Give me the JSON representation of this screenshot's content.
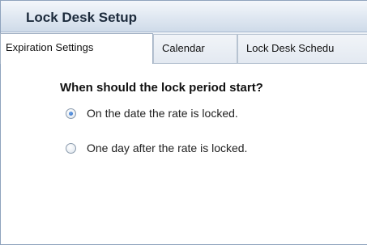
{
  "window": {
    "title": "Lock Desk Setup"
  },
  "tabs": [
    {
      "label": "Expiration Settings",
      "active": true
    },
    {
      "label": "Calendar",
      "active": false
    },
    {
      "label": "Lock Desk Schedu",
      "active": false
    }
  ],
  "question": {
    "text": "When should the lock period start?"
  },
  "options": [
    {
      "label": "On the date the rate is locked.",
      "selected": true
    },
    {
      "label": "One day after the rate is locked.",
      "selected": false
    }
  ]
}
